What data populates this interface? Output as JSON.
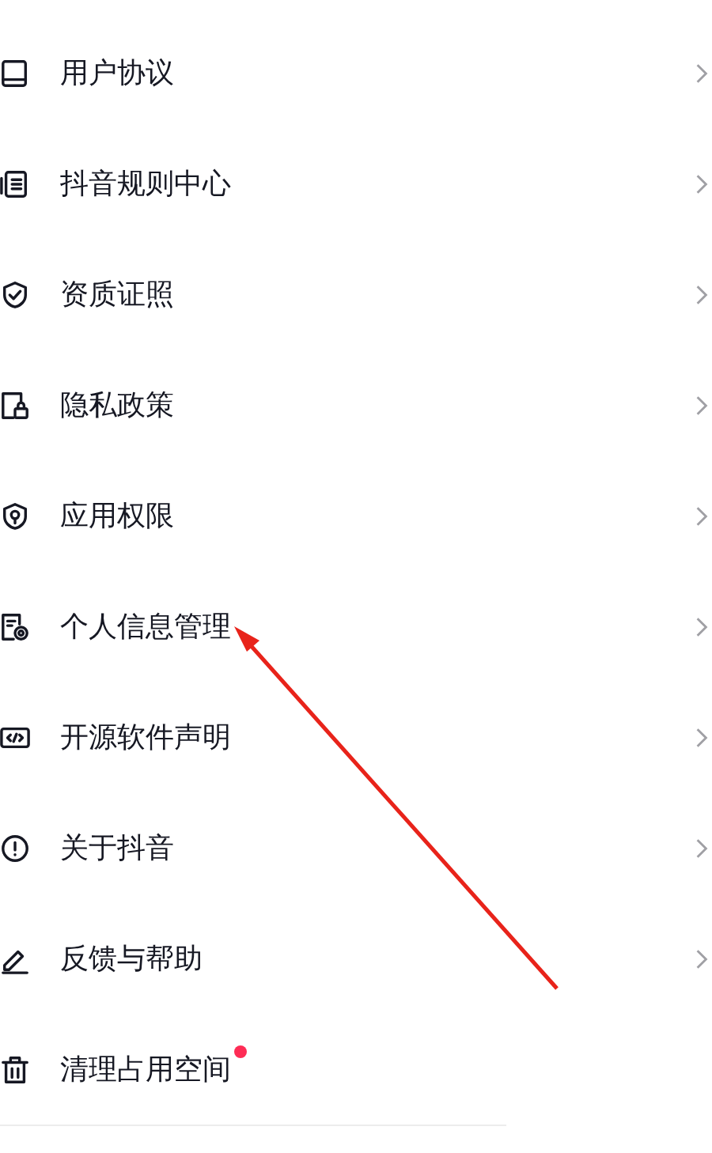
{
  "menu_items": [
    {
      "label": "用户协议",
      "chevron": true,
      "dot": false
    },
    {
      "label": "抖音规则中心",
      "chevron": true,
      "dot": false
    },
    {
      "label": "资质证照",
      "chevron": true,
      "dot": false
    },
    {
      "label": "隐私政策",
      "chevron": true,
      "dot": false
    },
    {
      "label": "应用权限",
      "chevron": true,
      "dot": false
    },
    {
      "label": "个人信息管理",
      "chevron": true,
      "dot": false
    },
    {
      "label": "开源软件声明",
      "chevron": true,
      "dot": false
    },
    {
      "label": "关于抖音",
      "chevron": true,
      "dot": false
    },
    {
      "label": "反馈与帮助",
      "chevron": true,
      "dot": false
    },
    {
      "label": "清理占用空间",
      "chevron": false,
      "dot": true
    }
  ]
}
